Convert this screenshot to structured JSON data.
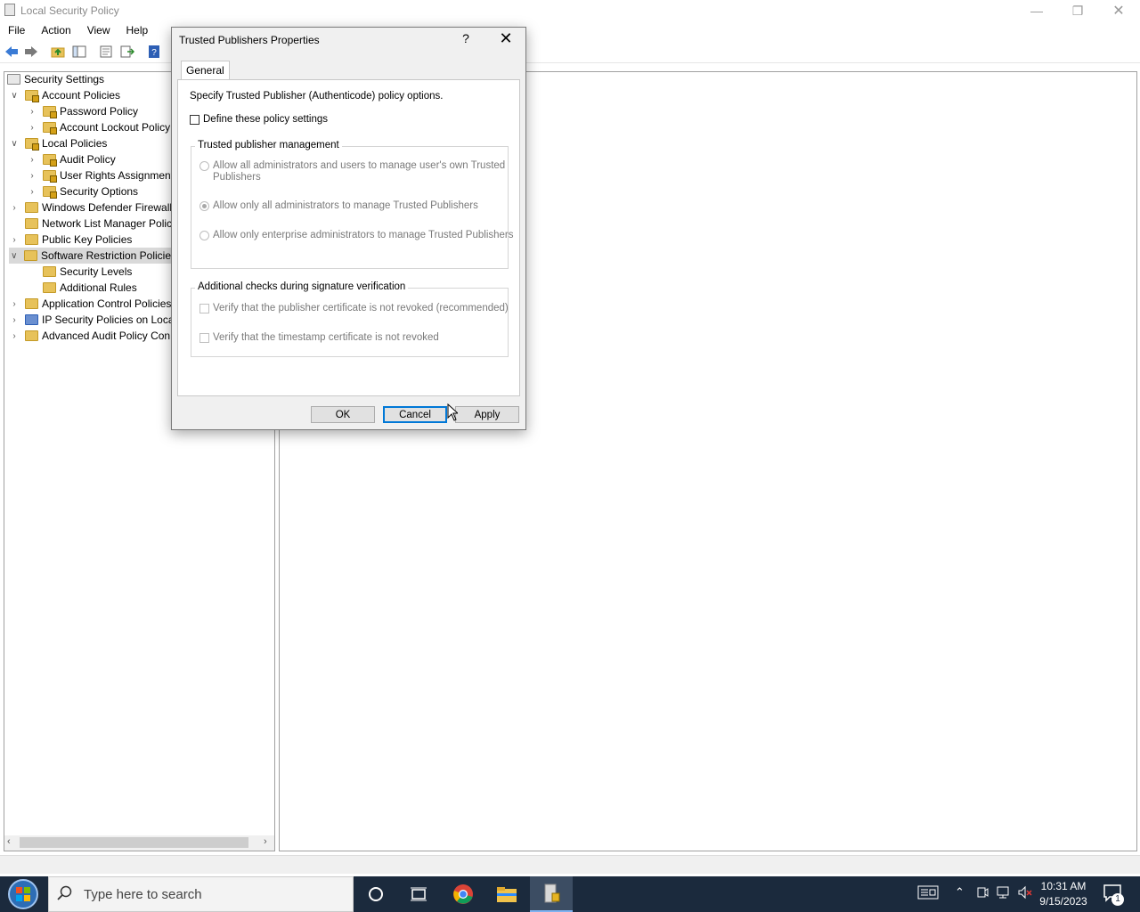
{
  "window": {
    "title": "Local Security Policy",
    "menu": [
      "File",
      "Action",
      "View",
      "Help"
    ]
  },
  "tree": {
    "items": [
      {
        "label": "Security Settings"
      },
      {
        "label": "Account Policies"
      },
      {
        "label": "Password Policy"
      },
      {
        "label": "Account Lockout Policy"
      },
      {
        "label": "Local Policies"
      },
      {
        "label": "Audit Policy"
      },
      {
        "label": "User Rights Assignment"
      },
      {
        "label": "Security Options"
      },
      {
        "label": "Windows Defender Firewall"
      },
      {
        "label": "Network List Manager Polic"
      },
      {
        "label": "Public Key Policies"
      },
      {
        "label": "Software Restriction Policie"
      },
      {
        "label": "Security Levels"
      },
      {
        "label": "Additional Rules"
      },
      {
        "label": "Application Control Policies"
      },
      {
        "label": "IP Security Policies on Loca"
      },
      {
        "label": "Advanced Audit Policy Con"
      }
    ]
  },
  "dialog": {
    "title": "Trusted Publishers Properties",
    "help": "?",
    "close": "✕",
    "tab": "General",
    "intro": "Specify Trusted Publisher (Authenticode) policy options.",
    "define_label": "Define these policy settings",
    "group1": {
      "legend": "Trusted publisher management",
      "opt1_line1": "Allow all administrators and users to manage user's own Trusted",
      "opt1_line2": "Publishers",
      "opt2": "Allow only all administrators to manage Trusted Publishers",
      "opt3": "Allow only enterprise administrators to manage Trusted Publishers"
    },
    "group2": {
      "legend": "Additional checks during signature verification",
      "chk1": "Verify that the publisher certificate is not revoked (recommended)",
      "chk2": "Verify that the timestamp certificate is not revoked"
    },
    "buttons": {
      "ok": "OK",
      "cancel": "Cancel",
      "apply": "Apply"
    }
  },
  "taskbar": {
    "search_placeholder": "Type here to search",
    "time": "10:31 AM",
    "date": "9/15/2023",
    "notifications": "1"
  }
}
